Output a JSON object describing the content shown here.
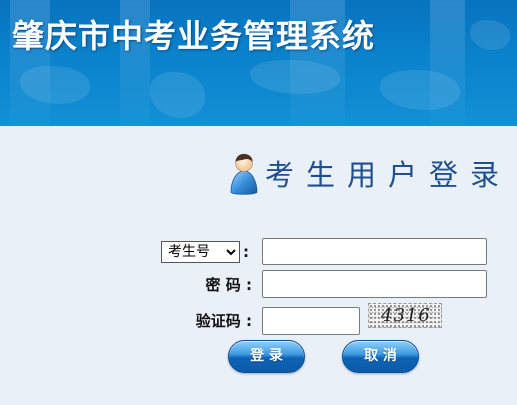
{
  "app": {
    "title": "肇庆市中考业务管理系统"
  },
  "login": {
    "heading": "考生用户登录",
    "id_type": {
      "selected": "考生号",
      "colon": ":"
    },
    "username": {
      "value": "",
      "placeholder": ""
    },
    "password": {
      "label": "密 码 :",
      "value": "",
      "placeholder": ""
    },
    "captcha": {
      "label": "验证码 :",
      "value": "",
      "placeholder": "",
      "code": "4316"
    },
    "buttons": {
      "login": "登 录",
      "cancel": "取 消"
    }
  },
  "icons": {
    "heading": "user-avatar-icon",
    "select": "chevron-down-icon"
  },
  "colors": {
    "banner": "#0a82cc",
    "page_background": "#eaf0f8",
    "heading_text": "#1f4f8f",
    "button": "#0f63b5"
  }
}
